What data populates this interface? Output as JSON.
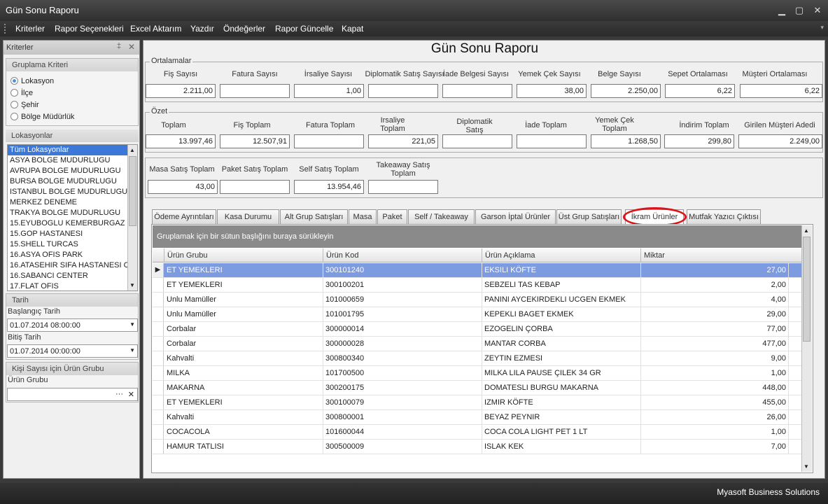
{
  "window": {
    "title": "Gün Sonu Raporu",
    "minimize": "▁",
    "maximize": "▢",
    "close": "✕"
  },
  "menu": [
    "Kriterler",
    "Rapor Seçenekleri",
    "Excel Aktarım",
    "Yazdır",
    "Öndeğerler",
    "Rapor Güncelle",
    "Kapat"
  ],
  "menu_overflow": "▾",
  "left": {
    "header": "Kriterler",
    "pin": "‡",
    "close": "✕",
    "group_title": "Gruplama Kriteri",
    "radios": [
      {
        "label": "Lokasyon",
        "selected": true
      },
      {
        "label": "İlçe",
        "selected": false
      },
      {
        "label": "Şehir",
        "selected": false
      },
      {
        "label": "Bölge Müdürlük",
        "selected": false
      }
    ],
    "locations_title": "Lokasyonlar",
    "locations": [
      "Tüm Lokasyonlar",
      "ASYA BOLGE MUDURLUGU",
      "AVRUPA BOLGE MUDURLUGU",
      "BURSA BOLGE MUDURLUGU",
      "ISTANBUL BOLGE MUDURLUGU",
      "MERKEZ DENEME",
      "TRAKYA BOLGE MUDURLUGU",
      "15.EYUBOGLU KEMERBURGAZ",
      "15.GOP HASTANESI",
      "15.SHELL TURCAS",
      "16.ASYA OFIS PARK",
      "16.ATASEHIR SIFA HASTANESI CA",
      "16.SABANCI CENTER",
      "17.FLAT OFIS"
    ],
    "date_title": "Tarih",
    "start_label": "Başlangıç Tarih",
    "start_value": "01.07.2014 08:00:00",
    "end_label": "Bitiş Tarih",
    "end_value": "01.07.2014 00:00:00",
    "group2_title": "Kişi Sayısı için Ürün Grubu",
    "product_group_label": "Ürün Grubu",
    "product_group_value": "",
    "ellipsis": "···",
    "clear": "✕"
  },
  "report": {
    "title": "Gün Sonu Raporu",
    "averages": {
      "legend": "Ortalamalar",
      "fields": [
        {
          "label": "Fiş Sayısı",
          "value": "2.211,00"
        },
        {
          "label": "Fatura Sayısı",
          "value": ""
        },
        {
          "label": "İrsaliye Sayısı",
          "value": "1,00"
        },
        {
          "label": "Diplomatik Satış Sayısı",
          "value": ""
        },
        {
          "label": "İade Belgesi Sayısı",
          "value": ""
        },
        {
          "label": "Yemek Çek Sayısı",
          "value": "38,00"
        },
        {
          "label": "Belge Sayısı",
          "value": "2.250,00"
        },
        {
          "label": "Sepet Ortalaması",
          "value": "6,22"
        },
        {
          "label": "Müşteri Ortalaması",
          "value": "6,22"
        }
      ]
    },
    "summary": {
      "legend": "Özet",
      "fields": [
        {
          "label": "Toplam",
          "value": "13.997,46"
        },
        {
          "label": "Fiş Toplam",
          "value": "12.507,91"
        },
        {
          "label": "Fatura Toplam",
          "value": ""
        },
        {
          "label": "Irsaliye Toplam",
          "value": "221,05"
        },
        {
          "label": "Diplomatik Satış",
          "value": ""
        },
        {
          "label": "İade Toplam",
          "value": ""
        },
        {
          "label": "Yemek Çek Toplam",
          "value": "1.268,50"
        },
        {
          "label": "İndirim Toplam",
          "value": "299,80"
        },
        {
          "label": "Girilen Müşteri Adedi",
          "value": "2.249,00"
        }
      ]
    },
    "sales": [
      {
        "label": "Masa Satış Toplam",
        "value": "43,00"
      },
      {
        "label": "Paket Satış Toplam",
        "value": ""
      },
      {
        "label": "Self Satış Toplam",
        "value": "13.954,46"
      },
      {
        "label": "Takeaway Satış Toplam",
        "value": ""
      }
    ]
  },
  "tabs": [
    "Ödeme Ayrıntıları",
    "Kasa Durumu",
    "Alt Grup Satışları",
    "Masa",
    "Paket",
    "Self / Takeaway",
    "Garson İptal Ürünler",
    "Üst Grup Satışları",
    "İkram Ürünler",
    "Mutfak Yazıcı Çıktısı"
  ],
  "active_tab": "İkram Ürünler",
  "highlight_color": "#d9141b",
  "grid": {
    "group_hint": "Gruplamak için bir sütun başlığını buraya sürükleyin",
    "columns": [
      "Ürün Grubu",
      "Ürün Kod",
      "Ürün Açıklama",
      "Miktar"
    ],
    "current_row_marker": "▶",
    "rows": [
      [
        "ET YEMEKLERI",
        "300101240",
        "EKSILI KÖFTE",
        "27,00"
      ],
      [
        "ET YEMEKLERI",
        "300100201",
        "SEBZELI TAS KEBAP",
        "2,00"
      ],
      [
        "Unlu Mamüller",
        "101000659",
        "PANINI AYCEKIRDEKLI UCGEN EKMEK",
        "4,00"
      ],
      [
        "Unlu Mamüller",
        "101001795",
        "KEPEKLI BAGET EKMEK",
        "29,00"
      ],
      [
        "Corbalar",
        "300000014",
        "EZOGELIN ÇORBA",
        "77,00"
      ],
      [
        "Corbalar",
        "300000028",
        "MANTAR CORBA",
        "477,00"
      ],
      [
        "Kahvalti",
        "300800340",
        "ZEYTIN EZMESI",
        "9,00"
      ],
      [
        "MILKA",
        "101700500",
        "MILKA LILA PAUSE ÇILEK 34 GR",
        "1,00"
      ],
      [
        "MAKARNA",
        "300200175",
        "DOMATESLI BURGU MAKARNA",
        "448,00"
      ],
      [
        "ET YEMEKLERI",
        "300100079",
        "IZMIR KÖFTE",
        "455,00"
      ],
      [
        "Kahvalti",
        "300800001",
        "BEYAZ PEYNIR",
        "26,00"
      ],
      [
        "COCACOLA",
        "101600044",
        "COCA COLA LIGHT PET 1 LT",
        "1,00"
      ],
      [
        "HAMUR TATLISI",
        "300500009",
        "ISLAK KEK",
        "7,00"
      ]
    ]
  },
  "status": {
    "text": "Myasoft Business Solutions"
  }
}
